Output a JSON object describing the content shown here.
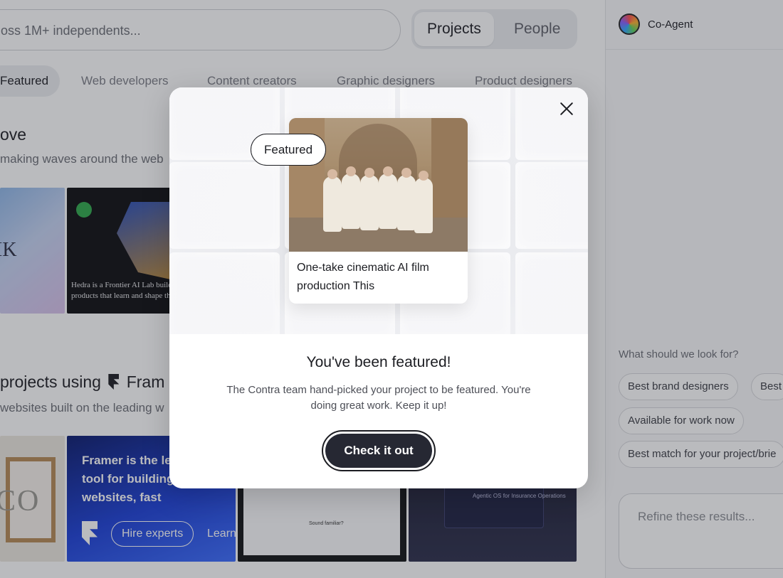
{
  "search": {
    "placeholder": "oss 1M+ independents..."
  },
  "toggle": {
    "projects": "Projects",
    "people": "People"
  },
  "categories": [
    "Featured",
    "Web developers",
    "Content creators",
    "Graphic designers",
    "Product designers"
  ],
  "section1": {
    "title": "ove",
    "subtitle": "making waves around the web"
  },
  "section2": {
    "title": "projects using",
    "title_suffix": "Fram",
    "subtitle": "websites built on the leading w"
  },
  "cards": {
    "c1_text": "IK",
    "c2_text": "Hedra is a Frontier AI Lab building products that learn and shape the",
    "c3_text": "CO",
    "c4_text": "Framer is the leading tool for building websites, fast",
    "c4_pill": "Hire experts",
    "c4_learn": "Learn",
    "c5_text": "Sound familiar?",
    "c6_text": "Agentic OS for Insurance Operations"
  },
  "agent": {
    "name": "Co-Agent",
    "prompt": "What should we look for?",
    "chips": [
      "Best brand designers",
      "Best",
      "Available for work now",
      "Best match for your project/brie"
    ],
    "refine_placeholder": "Refine these results..."
  },
  "modal": {
    "badge": "Featured",
    "project_title": "One-take cinematic AI film production This",
    "title": "You've been featured!",
    "body": "The Contra team hand-picked your project to be featured. You're doing great work. Keep it up!",
    "cta": "Check it out"
  }
}
